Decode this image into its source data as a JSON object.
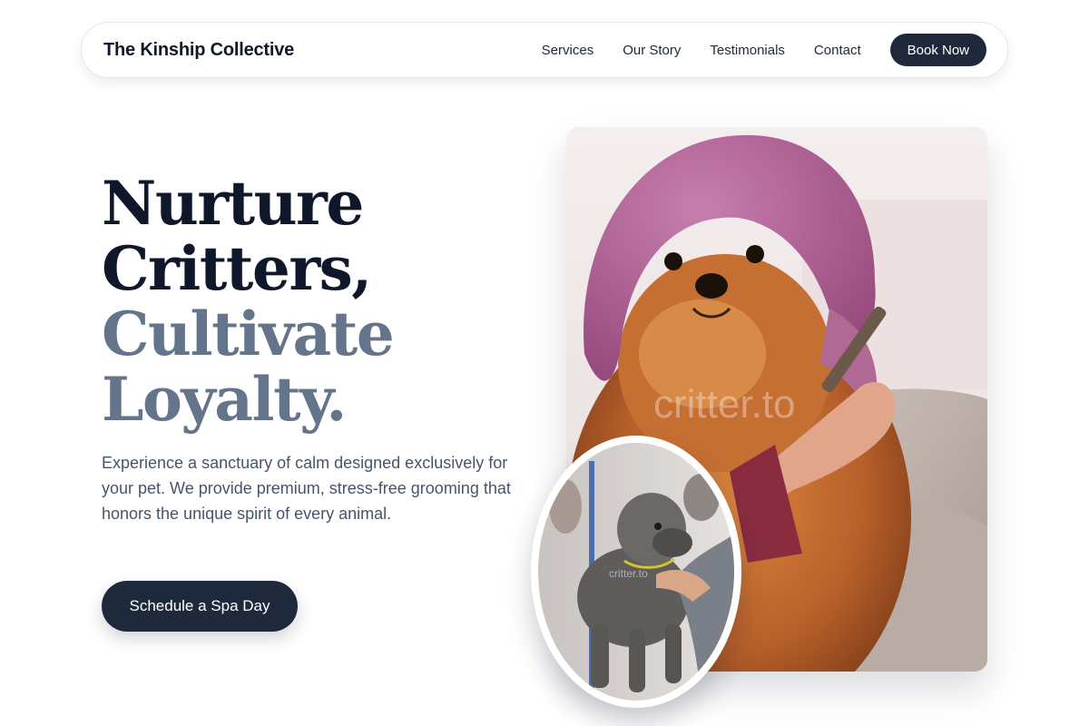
{
  "nav": {
    "brand": "The Kinship Collective",
    "links": [
      "Services",
      "Our Story",
      "Testimonials",
      "Contact"
    ],
    "book_label": "Book Now"
  },
  "hero": {
    "headline_line1": "Nurture",
    "headline_line2": "Critters,",
    "headline_line3": "Cultivate",
    "headline_line4": "Loyalty.",
    "description": "Experience a sanctuary of calm designed exclusively for your pet. We provide premium, stress-free grooming that honors the unique spirit of every animal.",
    "cta_label": "Schedule a Spa Day"
  },
  "images": {
    "main_watermark": "critter.to",
    "inset_watermark": "critter.to"
  },
  "colors": {
    "primary": "#1e293b",
    "headline_dark": "#0f172a",
    "headline_muted": "#64748b",
    "body_text": "#475569"
  }
}
